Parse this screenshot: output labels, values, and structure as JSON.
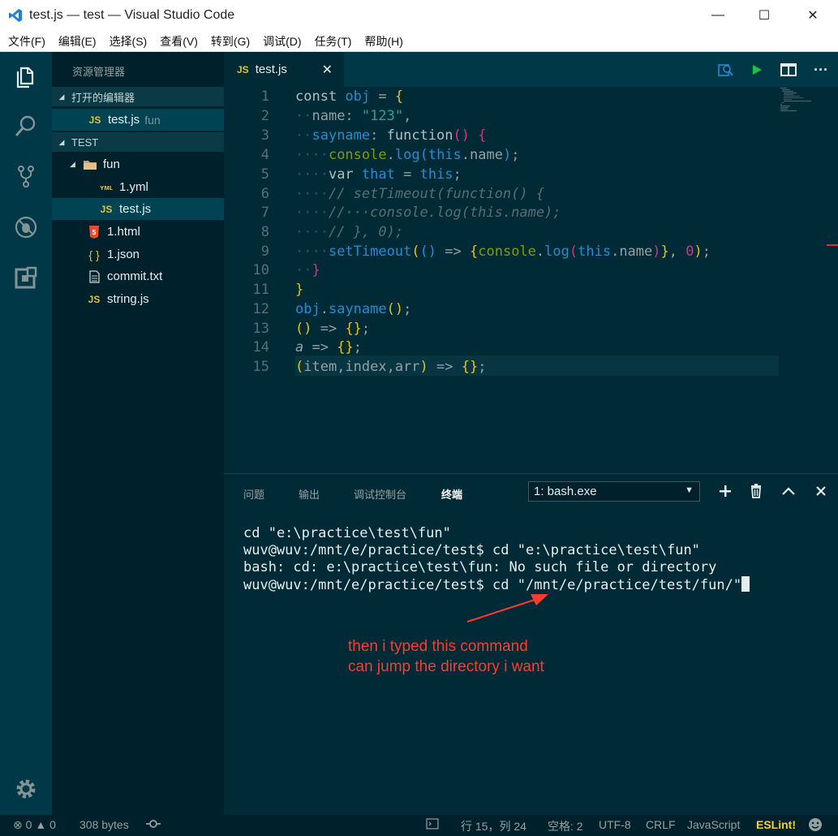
{
  "window": {
    "title": "test.js — test — Visual Studio Code",
    "minimize": "—",
    "maximize": "☐",
    "close": "✕"
  },
  "menu": [
    "文件(F)",
    "编辑(E)",
    "选择(S)",
    "查看(V)",
    "转到(G)",
    "调试(D)",
    "任务(T)",
    "帮助(H)"
  ],
  "sidebar": {
    "title": "资源管理器",
    "open_editors_label": "打开的编辑器",
    "open_editor": {
      "icon": "JS",
      "name": "test.js",
      "desc": "fun"
    },
    "folder_label": "TEST",
    "tree": [
      {
        "name": "fun",
        "icon": "folder-icon",
        "type": "folder"
      },
      {
        "name": "1.yml",
        "icon": "yml-icon",
        "type": "file"
      },
      {
        "name": "test.js",
        "icon": "JS",
        "type": "file"
      },
      {
        "name": "1.html",
        "icon": "html5-icon",
        "type": "file"
      },
      {
        "name": "1.json",
        "icon": "{ }",
        "type": "file"
      },
      {
        "name": "commit.txt",
        "icon": "text-file-icon",
        "type": "file"
      },
      {
        "name": "string.js",
        "icon": "JS",
        "type": "file"
      }
    ]
  },
  "editor": {
    "tab": {
      "icon": "JS",
      "label": "test.js",
      "close": "✕"
    },
    "line_numbers": [
      "1",
      "2",
      "3",
      "4",
      "5",
      "6",
      "7",
      "8",
      "9",
      "10",
      "11",
      "12",
      "13",
      "14",
      "15"
    ]
  },
  "panel": {
    "tabs": [
      "问题",
      "输出",
      "调试控制台",
      "终端"
    ],
    "active_tab": "终端",
    "terminal_select": "1: bash.exe",
    "terminal_lines": [
      "cd \"e:\\practice\\test\\fun\"",
      "wuv@wuv:/mnt/e/practice/test$ cd \"e:\\practice\\test\\fun\"",
      "bash: cd: e:\\practice\\test\\fun: No such file or directory",
      "wuv@wuv:/mnt/e/practice/test$ cd \"/mnt/e/practice/test/fun/\""
    ],
    "annotation": [
      "then i typed this command",
      "can jump the directory i want"
    ],
    "annotation_color": "#ff3b30"
  },
  "statusbar": {
    "errors": "0",
    "warnings": "0",
    "size": "308 bytes",
    "position": "行 15，列 24",
    "spaces": "空格: 2",
    "encoding": "UTF-8",
    "eol": "CRLF",
    "language": "JavaScript",
    "linter": "ESLint!"
  },
  "colors": {
    "background": "#002b36",
    "activity_bar": "#003847",
    "sidebar": "#00212b",
    "js_icon": "#e0c23c",
    "eslint": "#f4d22b"
  }
}
